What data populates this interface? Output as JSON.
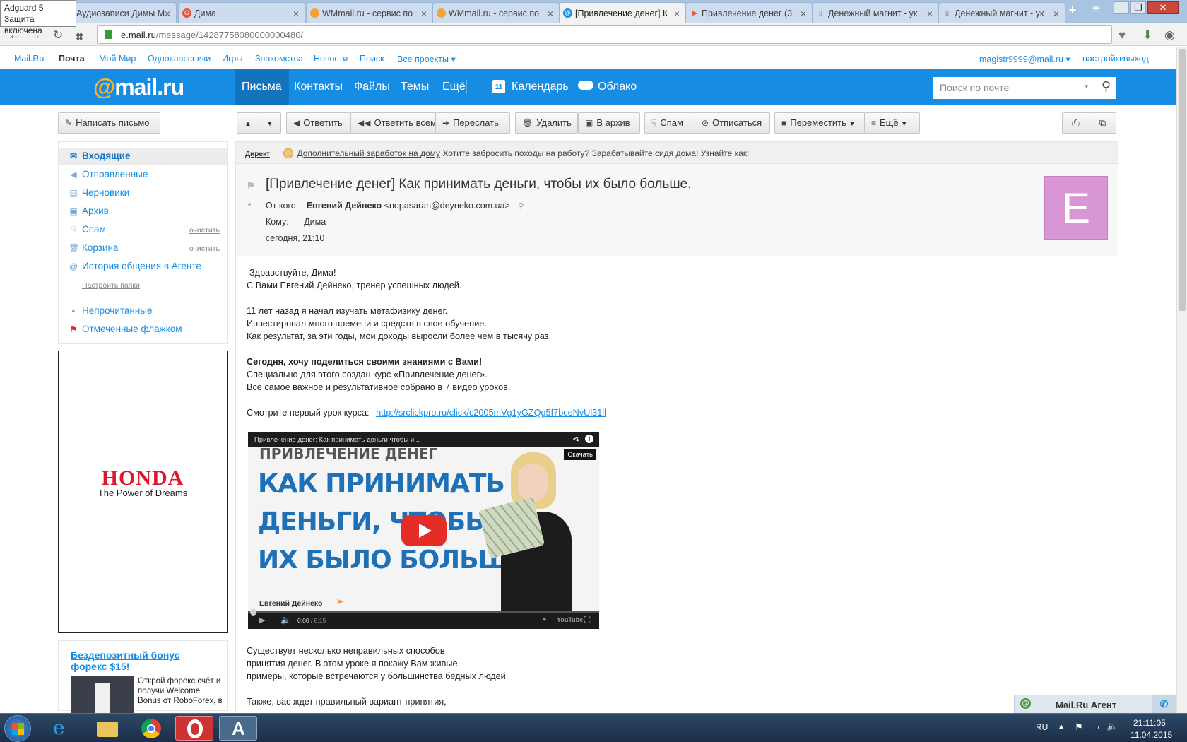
{
  "browser": {
    "tooltip": {
      "line1": "Adguard 5",
      "line2": "Защита включена"
    },
    "tabs": [
      {
        "title": "Аудиозаписи Димы М...",
        "fav": "adguard-icon",
        "active": false
      },
      {
        "title": "Дима",
        "fav": "opera-icon",
        "active": false
      },
      {
        "title": "WMmail.ru - сервис по",
        "fav": "wmmail-icon",
        "active": false
      },
      {
        "title": "WMmail.ru - сервис по",
        "fav": "wmmail-icon",
        "active": false
      },
      {
        "title": "[Привлечение денег] К",
        "fav": "mailru-icon",
        "active": true
      },
      {
        "title": "Привлечение денег (3",
        "fav": "arrow-icon",
        "active": false
      },
      {
        "title": "Денежный магнит - ук",
        "fav": "doc-icon",
        "active": false
      },
      {
        "title": "Денежный магнит - ук",
        "fav": "doc-icon",
        "active": false
      }
    ],
    "url_host": "e.mail.ru",
    "url_path": "/message/14287758080000000480/"
  },
  "portal": {
    "links": [
      "Mail.Ru",
      "Почта",
      "Мой Мир",
      "Одноклассники",
      "Игры",
      "Знакомства",
      "Новости",
      "Поиск",
      "Все проекты"
    ],
    "user": "magistr9999@mail.ru",
    "settings": "настройки",
    "logout": "выход"
  },
  "header": {
    "logo_at": "@",
    "logo_text": "mail.ru",
    "nav": [
      "Письма",
      "Контакты",
      "Файлы",
      "Темы",
      "Ещё"
    ],
    "calendar": "Календарь",
    "calendar_day": "11",
    "cloud": "Облако",
    "search_placeholder": "Поиск по почте"
  },
  "toolbar": {
    "compose": "Написать письмо",
    "reply": "Ответить",
    "reply_all": "Ответить всем",
    "forward": "Переслать",
    "delete": "Удалить",
    "archive": "В архив",
    "spam": "Спам",
    "unsubscribe": "Отписаться",
    "move": "Переместить",
    "more": "Ещё"
  },
  "folders": {
    "items": [
      {
        "label": "Входящие",
        "icon": "envelope-icon"
      },
      {
        "label": "Отправленные",
        "icon": "sent-icon"
      },
      {
        "label": "Черновики",
        "icon": "draft-icon"
      },
      {
        "label": "Архив",
        "icon": "archive-icon"
      },
      {
        "label": "Спам",
        "icon": "spam-icon",
        "action": "очистить"
      },
      {
        "label": "Корзина",
        "icon": "trash-icon",
        "action": "очистить"
      },
      {
        "label": "История общения в Агенте",
        "icon": "at-icon"
      }
    ],
    "configure": "Настроить папки",
    "unread": "Непрочитанные",
    "flagged": "Отмеченные флажком"
  },
  "ads": {
    "honda_brand": "HONDA",
    "honda_slogan": "The Power of Dreams",
    "forex_title": "Бездепозитный бонус форекс $15!",
    "forex_text": "Открой форекс счёт и получи Welcome Bonus от RoboForex, в"
  },
  "direct": {
    "label": "Директ",
    "link": "Дополнительный заработок на дому",
    "text": "Хотите забросить походы на работу? Зарабатывайте сидя дома! Узнайте как!"
  },
  "message": {
    "subject": "[Привлечение денег] Как принимать деньги, чтобы их было больше.",
    "from_label": "От кого:",
    "from_name": "Евгений Дейнеко",
    "from_email": "<nopasaran@deyneko.com.ua>",
    "to_label": "Кому:",
    "to": "Дима",
    "date": "сегодня, 21:10",
    "avatar_letter": "E",
    "lines": [
      "Здравствуйте, Дима!",
      "С Вами Евгений Дейнеко, тренер успешных людей.",
      "11 лет назад я начал изучать метафизику денег.",
      "Инвестировал много времени и средств в свое обучение.",
      "Как результат, за эти годы, мои доходы выросли более чем в тысячу раз.",
      "Сегодня, хочу поделиться своими знаниями с Вами!",
      "Специально для этого создан курс «Привлечение денег».",
      "Все самое важное и результативное собрано в 7 видео уроков.",
      "Смотрите первый урок курса:",
      "http://srclickpro.ru/click/c2005mVg1yGZQg5f7bceNvUl31ll",
      "Существует несколько неправильных способов",
      "принятия денег. В этом уроке я покажу Вам живые",
      "примеры, которые встречаются у большинства бедных людей.",
      "Также, вас ждет правильный вариант принятия,"
    ],
    "video": {
      "title": "Привлечение денег: Как принимать деньги чтобы и...",
      "download": "Скачать",
      "headline_top": "ПРИВЛЕЧЕНИЕ ДЕНЕГ",
      "headline_1": "КАК ПРИНИМАТЬ",
      "headline_2": "ДЕНЬГИ, ЧТОБЫ",
      "headline_3": "ИХ БЫЛО БОЛЬШЕ",
      "author": "Евгений Дейнеко",
      "time": "0:00",
      "duration": "/ 8:15",
      "youtube": "YouTube"
    }
  },
  "agent": {
    "label": "Mail.Ru Агент"
  },
  "taskbar": {
    "lang": "RU",
    "time": "21:11:05",
    "date": "11.04.2015"
  },
  "colors": {
    "brand_blue": "#168de2",
    "brand_orange": "#ffb12b",
    "avatar": "#d896d5"
  }
}
